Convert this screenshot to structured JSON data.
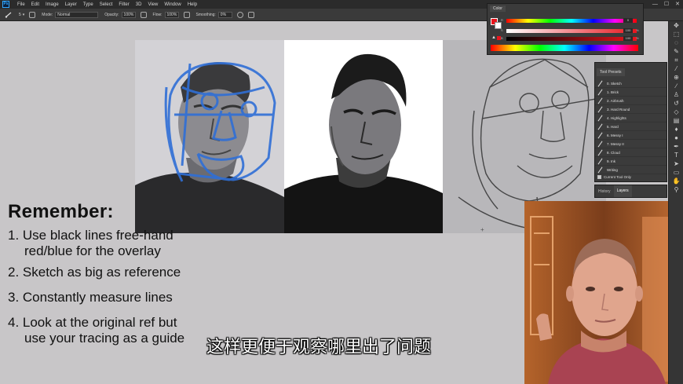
{
  "menubar": {
    "logo": "Ps",
    "items": [
      "File",
      "Edit",
      "Image",
      "Layer",
      "Type",
      "Select",
      "Filter",
      "3D",
      "View",
      "Window",
      "Help"
    ],
    "controls": [
      "—",
      "☐",
      "✕"
    ]
  },
  "options": {
    "brush_size": "5",
    "mode_label": "Mode:",
    "mode_value": "Normal",
    "opacity_label": "Opacity:",
    "opacity_value": "100%",
    "flow_label": "Flow:",
    "flow_value": "100%",
    "smoothing_label": "Smoothing:",
    "smoothing_value": "0%"
  },
  "color_panel": {
    "tab": "Color",
    "rows": [
      {
        "label": "R",
        "value": "0",
        "unit": ""
      },
      {
        "label": "S",
        "value": "100",
        "unit": "%"
      },
      {
        "label": "B",
        "value": "100",
        "unit": "%"
      }
    ],
    "foreground": "#e8141c",
    "background": "#ffffff"
  },
  "presets_panel": {
    "tab": "Tool Presets",
    "items": [
      "0. Sketch",
      "1. Brick",
      "2. Airbrush",
      "3. Hard Round",
      "4. Highlights",
      "5. Hard",
      "6. Messy I",
      "7. Messy II",
      "8. Cloud",
      "9. Ink",
      "Writing"
    ],
    "footer_label": "Current Tool Only"
  },
  "layers_panel": {
    "tabs": [
      "History",
      "Layers"
    ],
    "active": "Layers"
  },
  "notes": {
    "title": "Remember:",
    "items": [
      {
        "line1": "1. Use black lines free-hand",
        "line2": "red/blue for the overlay"
      },
      {
        "line1": "2. Sketch as big as reference",
        "line2": ""
      },
      {
        "line1": "3. Constantly measure lines",
        "line2": ""
      },
      {
        "line1": "4. Look at the original ref but",
        "line2": "use your tracing as a guide"
      }
    ]
  },
  "subtitle": "这样更便于观察哪里出了问题",
  "colors": {
    "overlay_blue": "#2f6fd6",
    "accent_red": "#e8141c"
  },
  "tools": [
    "move-icon",
    "marquee-icon",
    "lasso-icon",
    "quick-select-icon",
    "crop-icon",
    "eyedropper-icon",
    "healing-icon",
    "brush-icon",
    "stamp-icon",
    "history-brush-icon",
    "eraser-icon",
    "gradient-icon",
    "blur-icon",
    "dodge-icon",
    "pen-icon",
    "type-icon",
    "path-select-icon",
    "shape-icon",
    "hand-icon",
    "zoom-icon"
  ]
}
